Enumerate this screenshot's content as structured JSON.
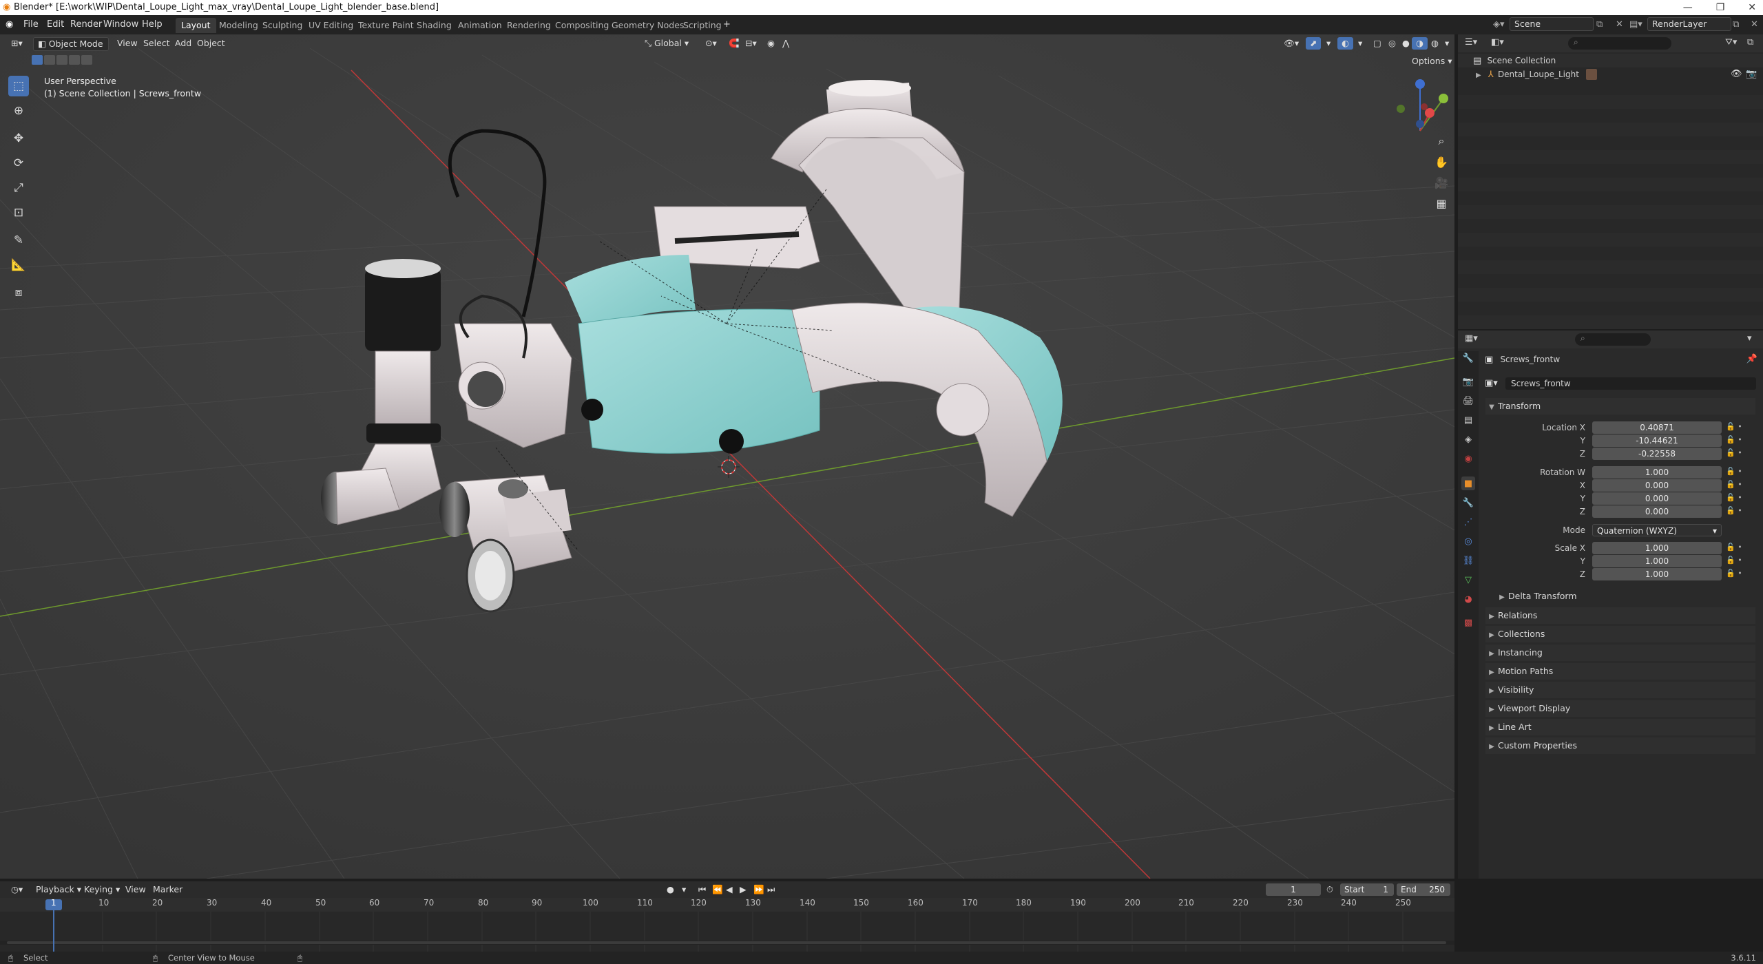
{
  "window": {
    "title": "Blender* [E:\\work\\WIP\\Dental_Loupe_Light_max_vray\\Dental_Loupe_Light_blender_base.blend]",
    "controls": [
      "—",
      "❐",
      "✕"
    ]
  },
  "menu": {
    "items": [
      "File",
      "Edit",
      "Render",
      "Window",
      "Help"
    ]
  },
  "workspaces": {
    "tabs": [
      "Layout",
      "Modeling",
      "Sculpting",
      "UV Editing",
      "Texture Paint",
      "Shading",
      "Animation",
      "Rendering",
      "Compositing",
      "Geometry Nodes",
      "Scripting"
    ],
    "active": "Layout",
    "add": "+"
  },
  "scene": {
    "name": "Scene",
    "render_layer": "RenderLayer"
  },
  "viewport": {
    "mode": "Object Mode",
    "menus": [
      "View",
      "Select",
      "Add",
      "Object"
    ],
    "orientation": "Global",
    "options": "Options",
    "overlay_title": "User Perspective",
    "overlay_subtitle": "(1) Scene Collection | Screws_frontw"
  },
  "outliner": {
    "root": "Scene Collection",
    "items": [
      {
        "label": "Dental_Loupe_Light"
      }
    ]
  },
  "properties": {
    "object_name": "Screws_frontw",
    "data_name": "Screws_frontw",
    "transform_title": "Transform",
    "location_label": "Location X",
    "location": {
      "x": "0.40871",
      "y": "-10.44621",
      "z": "-0.22558"
    },
    "rotation_label": "Rotation W",
    "rotation": {
      "w": "1.000",
      "x": "0.000",
      "y": "0.000",
      "z": "0.000"
    },
    "mode_label": "Mode",
    "mode_value": "Quaternion (WXYZ)",
    "scale_label": "Scale X",
    "scale": {
      "x": "1.000",
      "y": "1.000",
      "z": "1.000"
    },
    "axis_labels": {
      "x": "X",
      "y": "Y",
      "z": "Z"
    },
    "delta": "Delta Transform",
    "sections": [
      "Relations",
      "Collections",
      "Instancing",
      "Motion Paths",
      "Visibility",
      "Viewport Display",
      "Line Art",
      "Custom Properties"
    ]
  },
  "timeline": {
    "menus": [
      "Playback",
      "Keying",
      "View",
      "Marker"
    ],
    "current_frame": "1",
    "start_label": "Start",
    "start": "1",
    "end_label": "End",
    "end": "250",
    "ticks": [
      "1",
      "10",
      "20",
      "30",
      "40",
      "50",
      "60",
      "70",
      "80",
      "90",
      "100",
      "110",
      "120",
      "130",
      "140",
      "150",
      "160",
      "170",
      "180",
      "190",
      "200",
      "210",
      "220",
      "230",
      "240",
      "250"
    ]
  },
  "status": {
    "select": "Select",
    "center": "Center View to Mouse",
    "version": "3.6.11"
  },
  "colors": {
    "accent": "#4772b3",
    "axis_x": "#c03838",
    "axis_y": "#6e9a2d",
    "strap": "#8fd0cf",
    "body": "#d9d2d4"
  }
}
